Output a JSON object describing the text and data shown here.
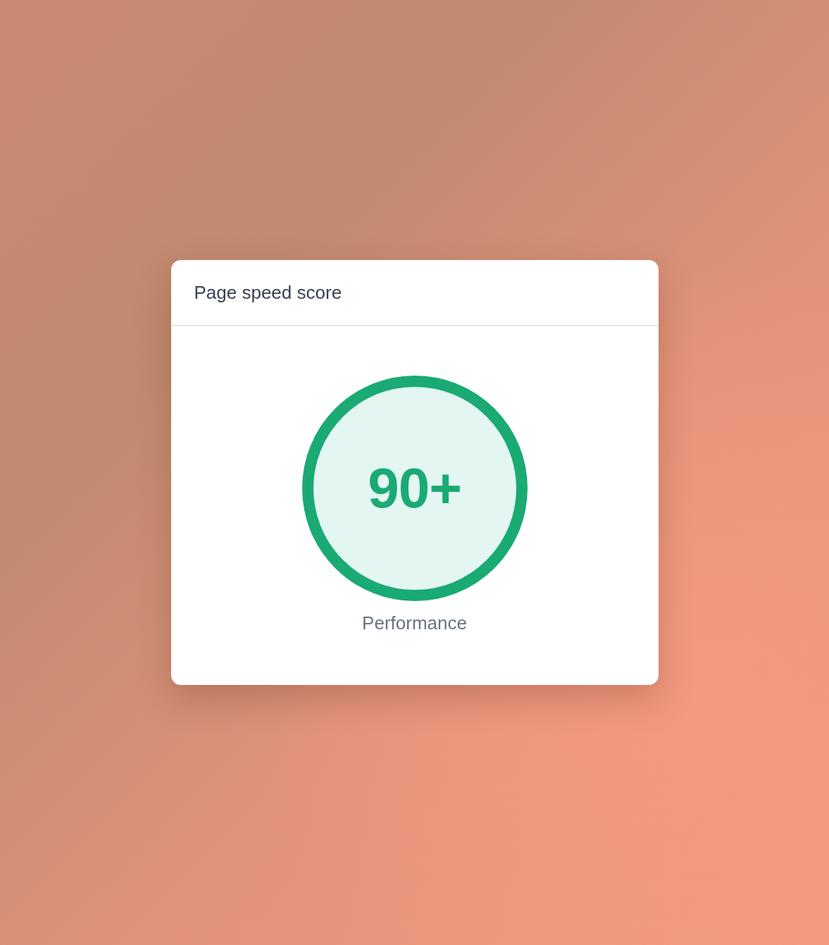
{
  "card": {
    "title": "Page speed score",
    "score": {
      "value": "90+",
      "label": "Performance"
    }
  }
}
